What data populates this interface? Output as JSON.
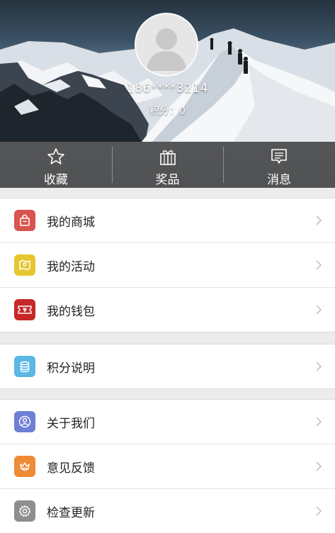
{
  "profile": {
    "phone": "186****3214",
    "points_text": "积分：0"
  },
  "tabs": [
    {
      "label": "收藏",
      "icon": "star-icon"
    },
    {
      "label": "奖品",
      "icon": "gift-icon"
    },
    {
      "label": "消息",
      "icon": "message-icon"
    }
  ],
  "menu": {
    "group1": [
      {
        "label": "我的商城",
        "icon": "shopping-bag-icon",
        "color": "#d9534f"
      },
      {
        "label": "我的活动",
        "icon": "map-icon",
        "color": "#e5c62f"
      },
      {
        "label": "我的钱包",
        "icon": "ticket-icon",
        "color": "#c62828"
      }
    ],
    "group2": [
      {
        "label": "积分说明",
        "icon": "coins-icon",
        "color": "#5bb8e3"
      }
    ],
    "group3": [
      {
        "label": "关于我们",
        "icon": "user-icon",
        "color": "#6f7fd6"
      },
      {
        "label": "意见反馈",
        "icon": "flower-icon",
        "color": "#ef8a35"
      },
      {
        "label": "检查更新",
        "icon": "gear-icon",
        "color": "#8e8e8e"
      }
    ]
  }
}
